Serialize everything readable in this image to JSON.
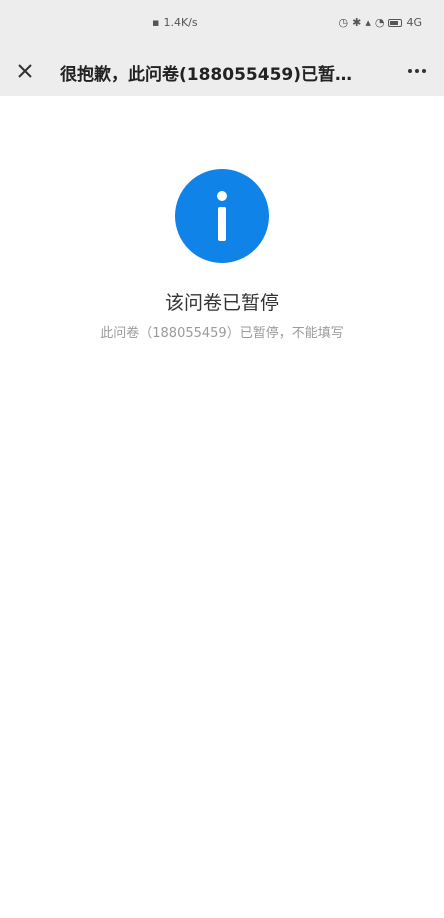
{
  "status_bar": {
    "center_text": "1.4K/s",
    "right_text": "4G",
    "center_icon": "notification-icon",
    "right_icons": [
      "alarm-icon",
      "bluetooth-icon",
      "signal-icon",
      "wifi-icon",
      "battery-icon"
    ]
  },
  "header": {
    "title": "很抱歉，此问卷(188055459)已暂…",
    "close_icon": "close-icon",
    "more_icon": "more-icon"
  },
  "message": {
    "icon": "info-icon",
    "icon_color": "#1083e8",
    "title": "该问卷已暂停",
    "description": "此问卷（188055459）已暂停，不能填写"
  }
}
